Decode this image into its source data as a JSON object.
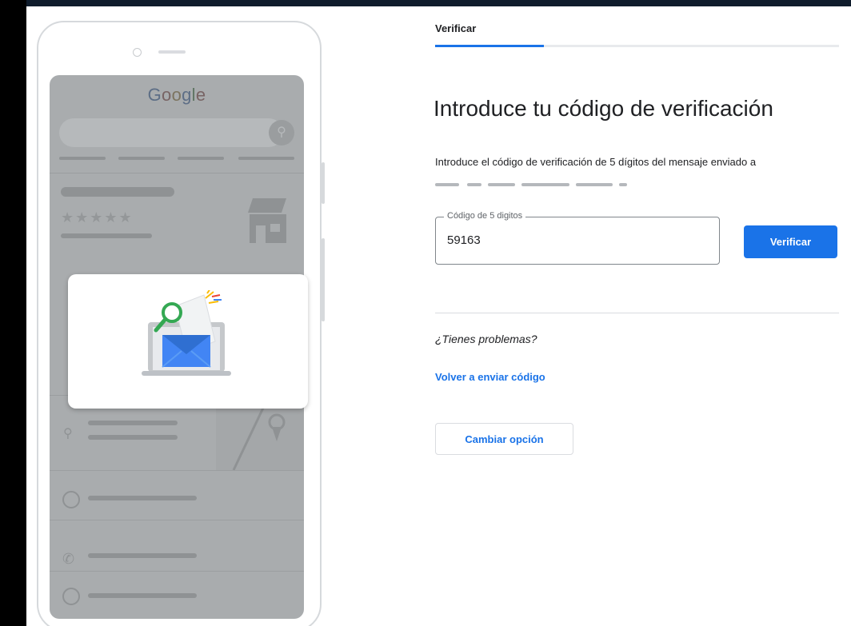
{
  "tab": {
    "label": "Verificar"
  },
  "heading": "Introduce tu código de verificación",
  "description": "Introduce el código de verificación de 5 dígitos del mensaje enviado a",
  "code_field": {
    "label": "Código de 5 digitos",
    "value": "59163"
  },
  "verify_button": "Verificar",
  "trouble_text": "¿Tienes problemas?",
  "resend_link": "Volver a enviar código",
  "change_option_button": "Cambiar opción",
  "illustration": {
    "logo": "Google"
  },
  "colors": {
    "accent": "#1a73e8",
    "text": "#202124",
    "divider": "#dadce0"
  }
}
